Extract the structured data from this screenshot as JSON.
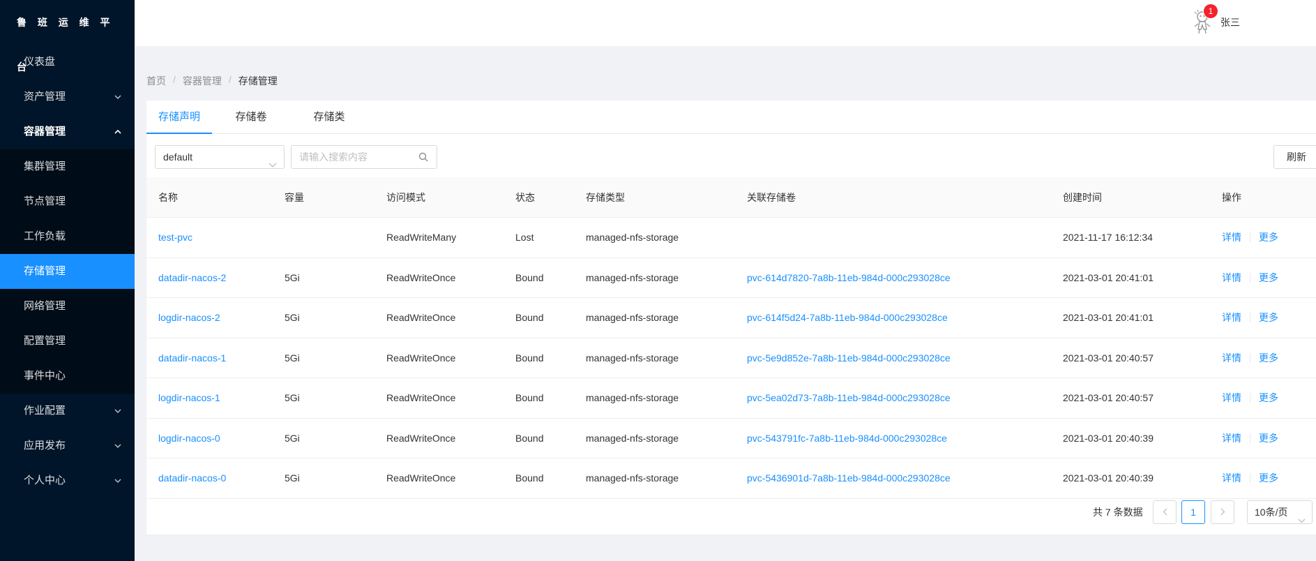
{
  "app": {
    "title": "鲁 班 运 维 平 台"
  },
  "sidebar": {
    "items": [
      {
        "label": "仪表盘"
      },
      {
        "label": "资产管理"
      },
      {
        "label": "容器管理"
      },
      {
        "label": "集群管理"
      },
      {
        "label": "节点管理"
      },
      {
        "label": "工作负载"
      },
      {
        "label": "存储管理"
      },
      {
        "label": "网络管理"
      },
      {
        "label": "配置管理"
      },
      {
        "label": "事件中心"
      },
      {
        "label": "作业配置"
      },
      {
        "label": "应用发布"
      },
      {
        "label": "个人中心"
      }
    ]
  },
  "header": {
    "notification_count": "1",
    "username": "张三"
  },
  "breadcrumb": {
    "items": [
      "首页",
      "容器管理",
      "存储管理"
    ],
    "separator": "/"
  },
  "tabs": [
    "存储声明",
    "存储卷",
    "存储类"
  ],
  "filter": {
    "namespace": "default",
    "search_placeholder": "请输入搜索内容",
    "refresh_label": "刷新"
  },
  "table": {
    "columns": [
      "名称",
      "容量",
      "访问模式",
      "状态",
      "存储类型",
      "关联存储卷",
      "创建时间",
      "操作"
    ],
    "rows": [
      {
        "name": "test-pvc",
        "capacity": "",
        "access_mode": "ReadWriteMany",
        "status": "Lost",
        "storage_class": "managed-nfs-storage",
        "volume": "",
        "created": "2021-11-17 16:12:34"
      },
      {
        "name": "datadir-nacos-2",
        "capacity": "5Gi",
        "access_mode": "ReadWriteOnce",
        "status": "Bound",
        "storage_class": "managed-nfs-storage",
        "volume": "pvc-614d7820-7a8b-11eb-984d-000c293028ce",
        "created": "2021-03-01 20:41:01"
      },
      {
        "name": "logdir-nacos-2",
        "capacity": "5Gi",
        "access_mode": "ReadWriteOnce",
        "status": "Bound",
        "storage_class": "managed-nfs-storage",
        "volume": "pvc-614f5d24-7a8b-11eb-984d-000c293028ce",
        "created": "2021-03-01 20:41:01"
      },
      {
        "name": "datadir-nacos-1",
        "capacity": "5Gi",
        "access_mode": "ReadWriteOnce",
        "status": "Bound",
        "storage_class": "managed-nfs-storage",
        "volume": "pvc-5e9d852e-7a8b-11eb-984d-000c293028ce",
        "created": "2021-03-01 20:40:57"
      },
      {
        "name": "logdir-nacos-1",
        "capacity": "5Gi",
        "access_mode": "ReadWriteOnce",
        "status": "Bound",
        "storage_class": "managed-nfs-storage",
        "volume": "pvc-5ea02d73-7a8b-11eb-984d-000c293028ce",
        "created": "2021-03-01 20:40:57"
      },
      {
        "name": "logdir-nacos-0",
        "capacity": "5Gi",
        "access_mode": "ReadWriteOnce",
        "status": "Bound",
        "storage_class": "managed-nfs-storage",
        "volume": "pvc-543791fc-7a8b-11eb-984d-000c293028ce",
        "created": "2021-03-01 20:40:39"
      },
      {
        "name": "datadir-nacos-0",
        "capacity": "5Gi",
        "access_mode": "ReadWriteOnce",
        "status": "Bound",
        "storage_class": "managed-nfs-storage",
        "volume": "pvc-5436901d-7a8b-11eb-984d-000c293028ce",
        "created": "2021-03-01 20:40:39"
      }
    ],
    "actions": {
      "detail": "详情",
      "more": "更多"
    }
  },
  "pagination": {
    "total_text": "共 7 条数据",
    "current_page": "1",
    "page_size": "10条/页"
  },
  "colors": {
    "sidebar_bg": "#001529",
    "accent": "#1890ff",
    "badge": "#f5222d"
  }
}
